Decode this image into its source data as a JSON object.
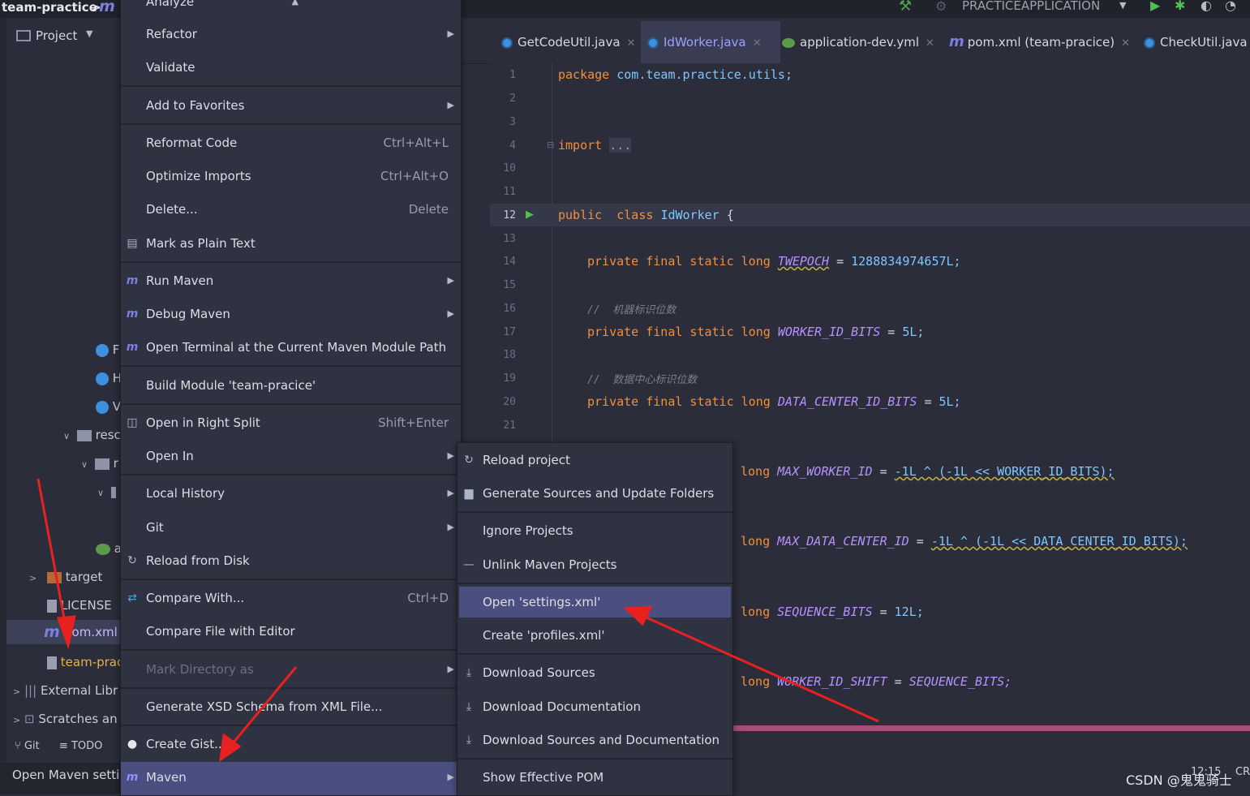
{
  "title_bar": {
    "project_name": "team-practice",
    "separator": ">"
  },
  "project_tab": {
    "label": "Project"
  },
  "tree": {
    "resources_label": "resc",
    "r_label": "r",
    "target_label": "target",
    "license_label": "LICENSE",
    "pom_label": "pom.xml",
    "team_label": "team-prac",
    "external_label": "External Libr",
    "scratches_label": "Scratches an",
    "c_items": [
      "F",
      "H",
      "V"
    ],
    "a_label": "a"
  },
  "bottom_tools": {
    "git": "Git",
    "todo": "TODO"
  },
  "status_bar": {
    "text": "Open Maven settin"
  },
  "run_config": {
    "name": "PRACTICEAPPLICATION"
  },
  "tabs": [
    {
      "label": "GetCodeUtil.java"
    },
    {
      "label": "IdWorker.java"
    },
    {
      "label": "application-dev.yml"
    },
    {
      "label": "pom.xml (team-pracice)"
    },
    {
      "label": "CheckUtil.java"
    }
  ],
  "code": {
    "line_numbers": [
      "1",
      "2",
      "3",
      "4",
      "10",
      "11",
      "12",
      "13",
      "14",
      "15",
      "16",
      "17",
      "18",
      "19",
      "20",
      "21"
    ],
    "package_kw": "package",
    "package_name": "com.team.practice.utils;",
    "import_kw": "import",
    "import_fold": "...",
    "public_kw": "public",
    "class_kw": "class",
    "class_name": "IdWorker",
    "brace": "{",
    "pfsl": "private final static long",
    "twepoch": "TWEPOCH",
    "twepoch_val": "1288834974657L;",
    "comment1": "//  机器标识位数",
    "worker_bits": "WORKER_ID_BITS",
    "worker_bits_val": "5L;",
    "comment2": "//  数据中心标识位数",
    "dc_bits": "DATA_CENTER_ID_BITS",
    "dc_bits_val": "5L;",
    "long_kw": "long",
    "max_worker": "MAX_WORKER_ID",
    "max_worker_expr": "-1L ^ (-1L << WORKER_ID_BITS);",
    "max_dc": "MAX_DATA_CENTER_ID",
    "max_dc_expr": "-1L ^ (-1L << DATA_CENTER_ID_BITS);",
    "seq_bits": "SEQUENCE_BITS",
    "seq_bits_val": "12L;",
    "worker_shift": "WORKER_ID_SHIFT",
    "worker_shift_val": "SEQUENCE_BITS;",
    "equals": "="
  },
  "context_menu": {
    "items": [
      {
        "label": "Analyze",
        "arrow": "▲"
      },
      {
        "label": "Refactor",
        "arrow": "▶"
      },
      {
        "label": "Validate"
      },
      {
        "label": "Add to Favorites",
        "arrow": "▶"
      },
      {
        "label": "Reformat Code",
        "shortcut": "Ctrl+Alt+L"
      },
      {
        "label": "Optimize Imports",
        "shortcut": "Ctrl+Alt+O"
      },
      {
        "label": "Delete...",
        "shortcut": "Delete"
      },
      {
        "label": "Mark as Plain Text"
      },
      {
        "label": "Run Maven",
        "arrow": "▶"
      },
      {
        "label": "Debug Maven",
        "arrow": "▶"
      },
      {
        "label": "Open Terminal at the Current Maven Module Path"
      },
      {
        "label": "Build Module 'team-pracice'"
      },
      {
        "label": "Open in Right Split",
        "shortcut": "Shift+Enter"
      },
      {
        "label": "Open In",
        "arrow": "▶"
      },
      {
        "label": "Local History",
        "arrow": "▶"
      },
      {
        "label": "Git",
        "arrow": "▶"
      },
      {
        "label": "Reload from Disk"
      },
      {
        "label": "Compare With...",
        "shortcut": "Ctrl+D"
      },
      {
        "label": "Compare File with Editor"
      },
      {
        "label": "Mark Directory as",
        "arrow": "▶"
      },
      {
        "label": "Generate XSD Schema from XML File..."
      },
      {
        "label": "Create Gist..."
      },
      {
        "label": "Maven",
        "arrow": "▶"
      }
    ]
  },
  "maven_submenu": {
    "items": [
      {
        "label": "Reload project"
      },
      {
        "label": "Generate Sources and Update Folders"
      },
      {
        "label": "Ignore Projects"
      },
      {
        "label": "Unlink Maven Projects"
      },
      {
        "label": "Open 'settings.xml'"
      },
      {
        "label": "Create 'profiles.xml'"
      },
      {
        "label": "Download Sources"
      },
      {
        "label": "Download Documentation"
      },
      {
        "label": "Download Sources and Documentation"
      },
      {
        "label": "Show Effective POM"
      }
    ]
  },
  "watermark": {
    "text": "CSDN @鬼鬼骑士",
    "time": "12:15",
    "cr": "CR"
  },
  "colors": {
    "accent": "#7e7ed8",
    "highlight": "#4a4f80",
    "annotation": "#e8201f"
  }
}
